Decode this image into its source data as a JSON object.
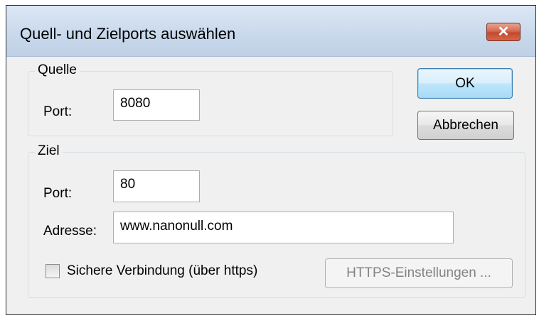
{
  "window": {
    "title": "Quell- und Zielports auswählen",
    "close_icon": "close-icon"
  },
  "source_group": {
    "legend": "Quelle",
    "port_label": "Port:",
    "port_value": "8080"
  },
  "target_group": {
    "legend": "Ziel",
    "port_label": "Port:",
    "port_value": "80",
    "address_label": "Adresse:",
    "address_value": "www.nanonull.com",
    "secure_checkbox_label": "Sichere Verbindung (über https)",
    "secure_checked": false,
    "https_settings_button": "HTTPS-Einstellungen ..."
  },
  "buttons": {
    "ok": "OK",
    "cancel": "Abbrechen"
  }
}
